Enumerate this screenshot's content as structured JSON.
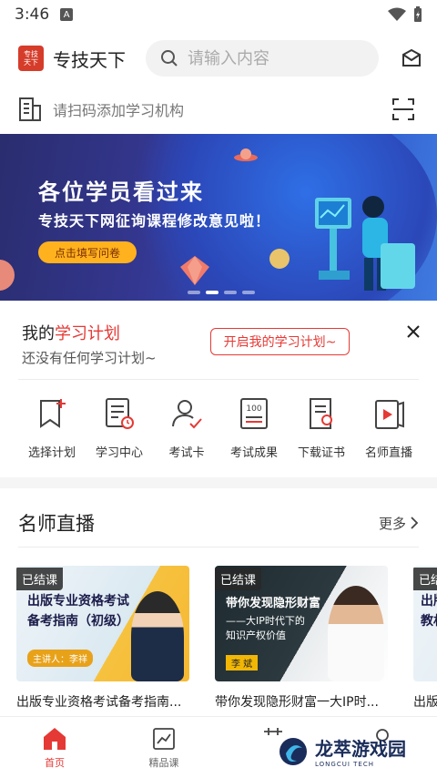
{
  "status": {
    "time": "3:46",
    "badge": "A"
  },
  "header": {
    "logo_text": "专技天下",
    "title": "专技天下",
    "search_placeholder": "请输入内容"
  },
  "org": {
    "label": "请扫码添加学习机构"
  },
  "banner": {
    "headline": "各位学员看过来",
    "subline": "专技天下网征询课程修改意见啦！",
    "cta": "点击填写问卷",
    "dots": 4,
    "active_dot": 1
  },
  "plan": {
    "title_prefix": "我的",
    "title_highlight": "学习计划",
    "subtitle": "还没有任何学习计划~",
    "start_button": "开启我的学习计划~"
  },
  "quick_entries": [
    {
      "label": "选择计划",
      "icon": "bookmark-plus-icon"
    },
    {
      "label": "学习中心",
      "icon": "list-clock-icon"
    },
    {
      "label": "考试卡",
      "icon": "user-check-icon"
    },
    {
      "label": "考试成果",
      "icon": "score-100-icon"
    },
    {
      "label": "下载证书",
      "icon": "certificate-icon"
    },
    {
      "label": "名师直播",
      "icon": "play-video-icon"
    }
  ],
  "live": {
    "title": "名师直播",
    "more": "更多",
    "cards": [
      {
        "tag": "已结课",
        "poster_line1": "出版专业资格考试",
        "poster_line2": "备考指南（初级）",
        "speaker": "主讲人：李祥",
        "caption": "出版专业资格考试备考指南..."
      },
      {
        "tag": "已结课",
        "poster_line1": "带你发现隐形财富",
        "poster_line2": "——大IP时代下的",
        "poster_line3": "知识产权价值",
        "speaker": "李 斌",
        "caption": "带你发现隐形财富一大IP时..."
      },
      {
        "tag": "已结",
        "poster_line1": "出版",
        "poster_line2": "教材",
        "speaker": "",
        "caption": "出版"
      }
    ]
  },
  "tabs": [
    {
      "label": "首页",
      "icon": "home-icon",
      "active": true
    },
    {
      "label": "精品课",
      "icon": "chart-board-icon",
      "active": false
    },
    {
      "label": "",
      "icon": "tab3-icon",
      "active": false
    },
    {
      "label": "",
      "icon": "tab4-icon",
      "active": false
    }
  ],
  "watermark": {
    "text": "龙萃游戏园",
    "sub": "LONGCUI TECH"
  },
  "colors": {
    "accent": "#e53935",
    "banner_cta": "#ffb21e"
  }
}
